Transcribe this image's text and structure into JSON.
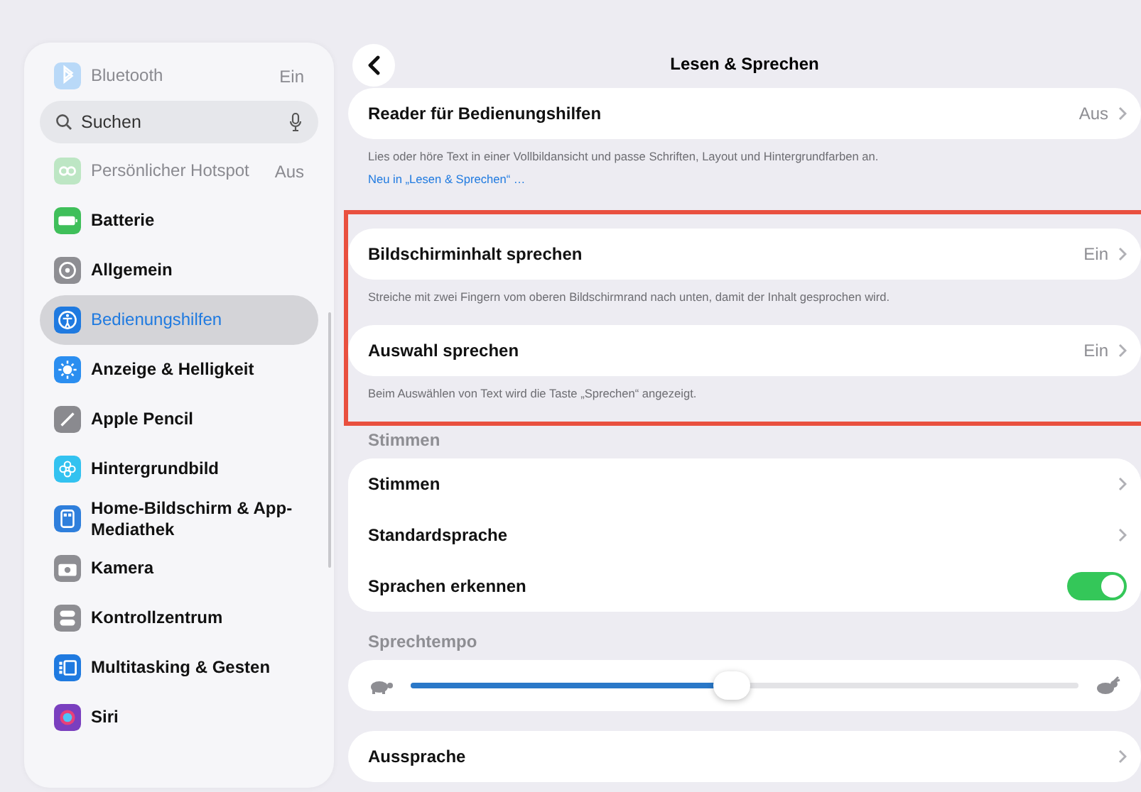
{
  "sidebar": {
    "items": [
      {
        "label": "Bluetooth",
        "value": "Ein",
        "dimmed": true,
        "selected": false,
        "color": "#b9d9f8"
      },
      {
        "kind": "search",
        "placeholder": "Suchen"
      },
      {
        "label": "Persönlicher Hotspot",
        "value": "Aus",
        "dimmed": true,
        "selected": false,
        "color": "#bde6c4"
      },
      {
        "label": "Batterie",
        "dimmed": false,
        "selected": false,
        "color": "#3fbf5a"
      },
      {
        "label": "Allgemein",
        "dimmed": false,
        "selected": false,
        "color": "#8e8e93"
      },
      {
        "label": "Bedienungshilfen",
        "dimmed": false,
        "selected": true,
        "color": "#1f7ae0"
      },
      {
        "label": "Anzeige & Helligkeit",
        "dimmed": false,
        "selected": false,
        "color": "#2b8ef0"
      },
      {
        "label": "Apple Pencil",
        "dimmed": false,
        "selected": false,
        "color": "#8a8a8f"
      },
      {
        "label": "Hintergrundbild",
        "dimmed": false,
        "selected": false,
        "color": "#33c2f0"
      },
      {
        "label": "Home-Bildschirm & App-Mediathek",
        "dimmed": false,
        "selected": false,
        "color": "#2f7fdc"
      },
      {
        "label": "Kamera",
        "dimmed": false,
        "selected": false,
        "color": "#8e8e93"
      },
      {
        "label": "Kontrollzentrum",
        "dimmed": false,
        "selected": false,
        "color": "#8e8e93"
      },
      {
        "label": "Multitasking & Gesten",
        "dimmed": false,
        "selected": false,
        "color": "#1f7ae0"
      },
      {
        "label": "Siri",
        "dimmed": false,
        "selected": false,
        "color": "#7a3fbf"
      }
    ]
  },
  "header": {
    "title": "Lesen & Sprechen"
  },
  "sections": [
    {
      "highlighted": false,
      "rows": [
        {
          "kind": "link",
          "label": "Reader für Bedienungshilfen",
          "value": "Aus",
          "footer": "Lies oder höre Text in einer Vollbildansicht und passe Schriften, Layout und Hintergrundfarben an.",
          "footer_link": "Neu in „Lesen & Sprechen“ …"
        }
      ]
    },
    {
      "highlighted": true,
      "rows": [
        {
          "kind": "link",
          "label": "Bildschirminhalt sprechen",
          "value": "Ein",
          "footer": "Streiche mit zwei Fingern vom oberen Bildschirmrand nach unten, damit der Inhalt gesprochen wird."
        },
        {
          "kind": "link",
          "label": "Auswahl sprechen",
          "value": "Ein",
          "footer": "Beim Auswählen von Text wird die Taste „Sprechen“ angezeigt."
        }
      ]
    },
    {
      "highlighted": false,
      "title": "Stimmen",
      "rows": [
        {
          "kind": "link",
          "label": "Stimmen"
        },
        {
          "kind": "link",
          "label": "Standardsprache"
        },
        {
          "kind": "toggle",
          "label": "Sprachen erkennen",
          "on": true
        }
      ]
    },
    {
      "highlighted": false,
      "title": "Sprechtempo",
      "rows": [
        {
          "kind": "slider",
          "level": 0.48
        }
      ]
    },
    {
      "highlighted": false,
      "rows": [
        {
          "kind": "link",
          "label": "Aussprache"
        }
      ]
    }
  ]
}
